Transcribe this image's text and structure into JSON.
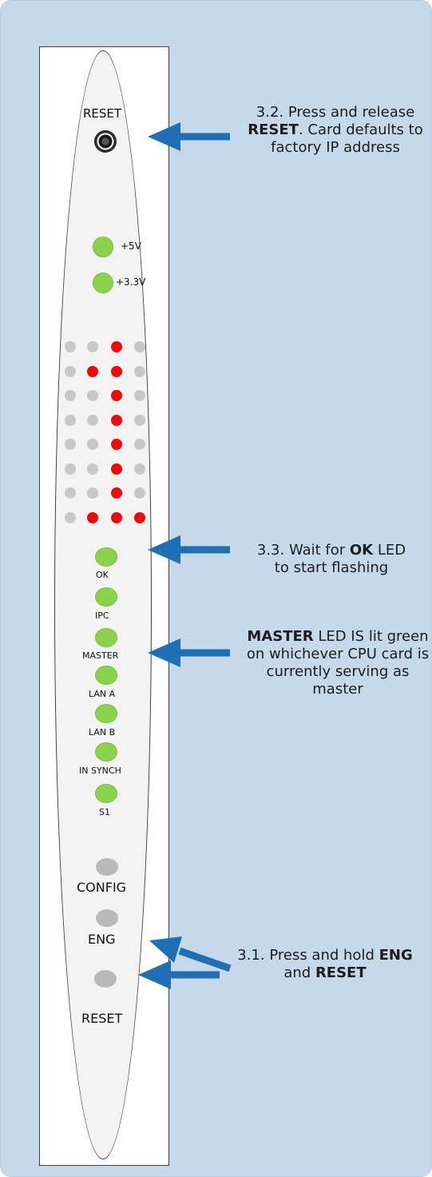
{
  "panel": {
    "top_reset_label": "RESET",
    "power_leds": [
      {
        "label": "+5V",
        "color": "green"
      },
      {
        "label": "+3.3V",
        "color": "green"
      }
    ],
    "matrix": [
      [
        "grey",
        "grey",
        "red",
        "grey"
      ],
      [
        "grey",
        "red",
        "red",
        "grey"
      ],
      [
        "grey",
        "grey",
        "red",
        "grey"
      ],
      [
        "grey",
        "grey",
        "red",
        "grey"
      ],
      [
        "grey",
        "grey",
        "red",
        "grey"
      ],
      [
        "grey",
        "grey",
        "red",
        "grey"
      ],
      [
        "grey",
        "grey",
        "red",
        "grey"
      ],
      [
        "grey",
        "red",
        "red",
        "red"
      ]
    ],
    "status_leds": [
      {
        "label": "OK",
        "color": "green"
      },
      {
        "label": "IPC",
        "color": "green"
      },
      {
        "label": "MASTER",
        "color": "green"
      },
      {
        "label": "LAN A",
        "color": "green"
      },
      {
        "label": "LAN B",
        "color": "green"
      },
      {
        "label": "IN SYNCH",
        "color": "green"
      },
      {
        "label": "S1",
        "color": "green"
      }
    ],
    "buttons": [
      {
        "label": "CONFIG"
      },
      {
        "label": "ENG"
      },
      {
        "label": "RESET"
      }
    ]
  },
  "colors": {
    "background": "#c5d9eb",
    "green_led": "#8cd34b",
    "red_led": "#f20808",
    "grey_led": "#c8c8c8",
    "arrow": "#1f6fb5"
  },
  "notes": {
    "n32": {
      "pre": "3.2. Press and release ",
      "bold": "RESET",
      "post": ". Card defaults to factory IP address"
    },
    "n33": {
      "pre": "3.3. Wait for ",
      "bold": "OK",
      "post": " LED to start flashing"
    },
    "master": {
      "bold": "MASTER",
      "post": " LED IS lit green on whichever CPU card is currently serving as master"
    },
    "n31": {
      "pre": "3.1. Press and hold ",
      "bold1": "ENG",
      "mid": " and ",
      "bold2": "RESET"
    }
  }
}
